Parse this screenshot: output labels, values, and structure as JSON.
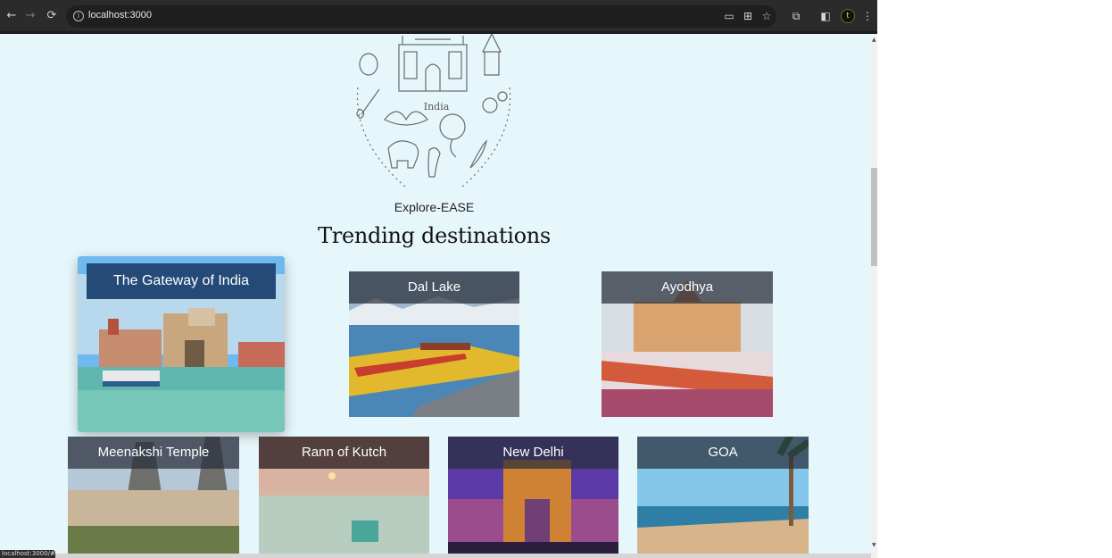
{
  "browser": {
    "url": "localhost:3000",
    "status_text": "localhost:3000/#"
  },
  "page": {
    "brand": "Explore-EASE",
    "heading": "Trending destinations",
    "logo_text": "India"
  },
  "destinations": [
    {
      "title": "The Gateway of India"
    },
    {
      "title": "Dal Lake"
    },
    {
      "title": "Ayodhya"
    },
    {
      "title": "Meenakshi Temple"
    },
    {
      "title": "Rann of Kutch"
    },
    {
      "title": "New Delhi"
    },
    {
      "title": "GOA"
    }
  ]
}
